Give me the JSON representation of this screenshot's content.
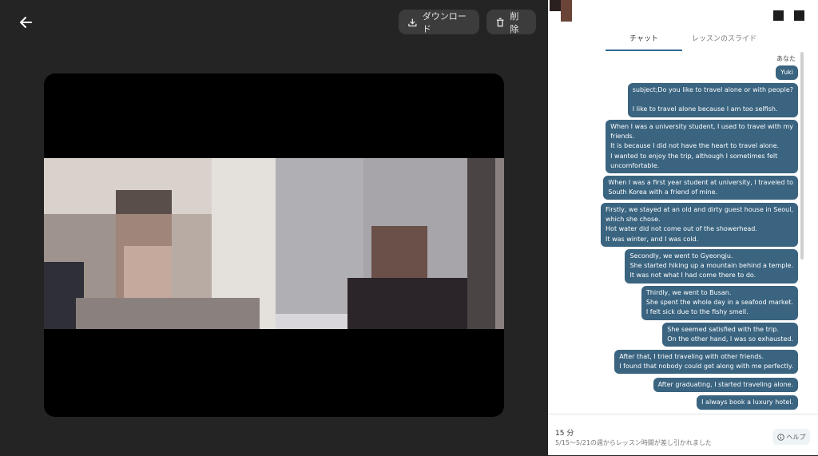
{
  "toolbar": {
    "download_label": "ダウンロード",
    "delete_label": "削除"
  },
  "icons": {
    "back": "arrow-left-icon",
    "download": "download-icon",
    "delete": "trash-icon",
    "help": "info-icon"
  },
  "tabs": [
    {
      "label": "チャット",
      "active": true
    },
    {
      "label": "レッスンのスライド",
      "active": false
    }
  ],
  "chat": {
    "sender": "あなた",
    "messages": [
      "Yuki",
      "subject;Do you like to travel alone or with people?\n\nI like to travel alone because I am too selfish.",
      "When I was a university student, I used to travel with my\nfriends.\nIt is because I did not have the heart to travel alone.\nI wanted to enjoy the trip, although I sometimes felt\nuncomfortable.",
      "When I was a first year student at university, I traveled to\nSouth Korea with a friend of mine.",
      "Firstly, we stayed at an old and dirty guest house in Seoul,\nwhich she chose.\nHot water did not come out of the showerhead.\nIt was winter, and I was cold.",
      "Secondly, we went to Gyeongju.\nShe started hiking up a mountain behind a temple.\nIt was not what I had come there to do.",
      "Thirdly, we went to Busan.\nShe spent the whole day in a seafood market.\nI felt sick due to the fishy smell.",
      "She seemed satisfied with the trip.\nOn the other hand, I was so exhausted.",
      "After that, I tried traveling with other friends.\nI found that nobody could get along with me perfectly.",
      "After graduating, I started traveling alone.",
      "I always book a luxury hotel."
    ]
  },
  "footer": {
    "minutes": "15 分",
    "notice": "5/15〜5/21の週からレッスン時間が差し引かれました",
    "help_label": "ヘルプ"
  },
  "colors": {
    "bubble": "#3a6480",
    "tab_underline": "#2f6a93",
    "left_bg": "#242424",
    "button_bg": "#3c3c3c"
  }
}
